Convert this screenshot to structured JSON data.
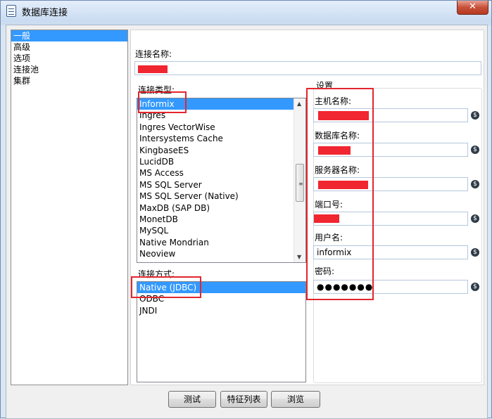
{
  "window": {
    "title": "数据库连接",
    "close_glyph": "✕"
  },
  "nav": {
    "items": [
      "一般",
      "高级",
      "选项",
      "连接池",
      "集群"
    ],
    "selected_index": 0
  },
  "form": {
    "connection_name_label": "连接名称:",
    "connection_type_label": "连接类型:",
    "connection_types": [
      "Informix",
      "Ingres",
      "Ingres VectorWise",
      "Intersystems Cache",
      "KingbaseES",
      "LucidDB",
      "MS Access",
      "MS SQL Server",
      "MS SQL Server (Native)",
      "MaxDB (SAP DB)",
      "MonetDB",
      "MySQL",
      "Native Mondrian",
      "Neoview"
    ],
    "connection_type_selected": "Informix",
    "access_label": "连接方式:",
    "access_methods": [
      "Native (JDBC)",
      "ODBC",
      "JNDI"
    ],
    "access_selected": "Native (JDBC)"
  },
  "settings": {
    "group_title": "设置",
    "host_label": "主机名称:",
    "database_label": "数据库名称:",
    "server_label": "服务器名称:",
    "port_label": "端口号:",
    "user_label": "用户名:",
    "user_value": "informix",
    "password_label": "密码:",
    "password_mask": "●●●●●●●"
  },
  "buttons": {
    "test": "测试",
    "features": "特征列表",
    "browse": "浏览"
  },
  "icons": {
    "variable": "variable-dollar-icon",
    "glyph": "$"
  },
  "colors": {
    "selection": "#3399ff",
    "annotation": "#e3262e",
    "redaction": "#f02631"
  }
}
